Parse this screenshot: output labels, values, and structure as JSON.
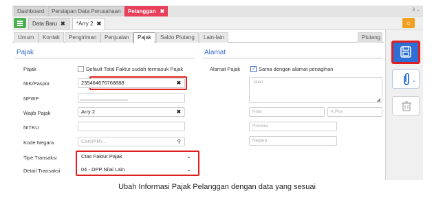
{
  "top_tabs": [
    {
      "label": "Dashboard",
      "active": false
    },
    {
      "label": "Persiapan Data Perusahaan",
      "active": false
    },
    {
      "label": "Pelanggan",
      "active": true,
      "close": "✖"
    }
  ],
  "top_tab_count": "3",
  "doc_tabs": [
    {
      "label": "Data Baru",
      "close": "✖",
      "active": false
    },
    {
      "label": "Arry 2",
      "prefix": "*",
      "close": "✖",
      "active": true
    }
  ],
  "sub_tabs": [
    "Umum",
    "Kontak",
    "Pengiriman",
    "Penjualan",
    "Pajak",
    "Saldo Piutang",
    "Lain-lain"
  ],
  "sub_tab_active": "Pajak",
  "sub_tab_right": "Piutang",
  "pajak": {
    "title": "Pajak",
    "pajak_label": "Pajak",
    "default_total_label": "Default Total Faktur sudah termasuk Pajak",
    "default_total_checked": false,
    "nik_label": "NIK/Paspor",
    "nik_value": "235464676768888",
    "npwp_label": "NPWP",
    "npwp_value": "",
    "wajib_pajak_label": "Wajib Pajak",
    "wajib_pajak_value": "Arry 2",
    "nitku_label": "NITKU",
    "nitku_value": "",
    "kode_negara_label": "Kode Negara",
    "kode_negara_placeholder": "Cari/Pilih...",
    "tipe_transaksi_label": "Tipe Transaksi",
    "tipe_transaksi_value": "Ctas Faktur Pajak",
    "detail_transaksi_label": "Detail Transaksi",
    "detail_transaksi_value": "04 - DPP Nilai Lain"
  },
  "alamat": {
    "title": "Alamat",
    "alamat_pajak_label": "Alamat Pajak",
    "sama_label": "Sama dengan alamat penagihan",
    "sama_checked": true,
    "jalan_placeholder": "Jalan",
    "kota_placeholder": "Kota",
    "kpos_placeholder": "K.Pos",
    "provinsi_placeholder": "Provinsi",
    "negara_placeholder": "Negara"
  },
  "icons": {
    "menu": "menu-icon",
    "orange": "tag-icon",
    "save": "save-icon",
    "attach": "paperclip-icon",
    "trash": "trash-icon"
  },
  "colors": {
    "active_tab": "#e8405b",
    "accent_blue": "#3a6cc4",
    "save_button": "#2d6fd6",
    "highlight": "#e02020",
    "menu_button": "#4caf50",
    "orange_button": "#f0a020"
  },
  "caption": "Ubah Informasi Pajak Pelanggan dengan data yang sesuai"
}
